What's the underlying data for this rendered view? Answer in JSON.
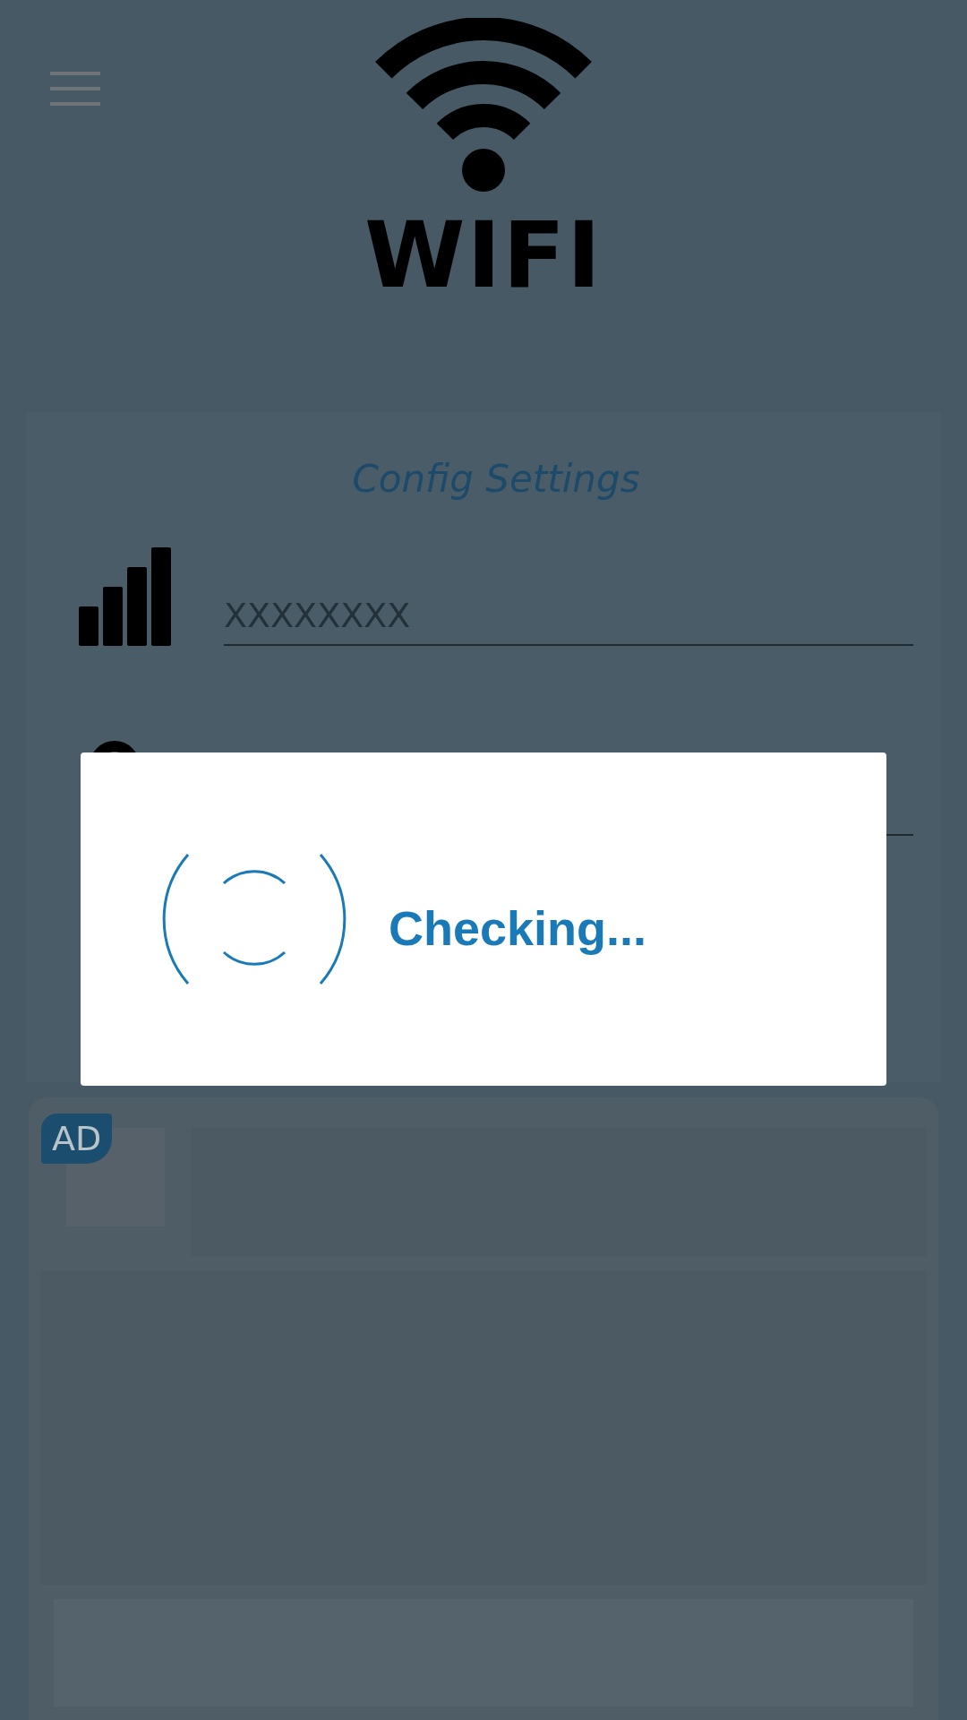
{
  "logo": {
    "text": "WIFI"
  },
  "config": {
    "title": "Config Settings",
    "fields": [
      {
        "kind": "ssid",
        "value": "XXXXXXXX"
      },
      {
        "kind": "password"
      }
    ]
  },
  "dialog": {
    "message": "Checking..."
  },
  "ad": {
    "badge": "AD"
  }
}
